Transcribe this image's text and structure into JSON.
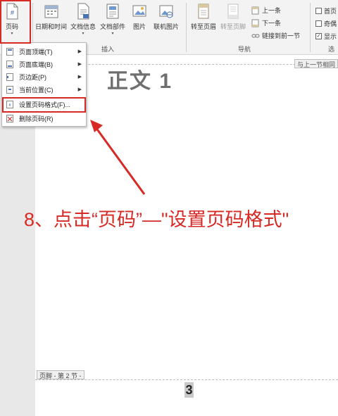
{
  "ribbon": {
    "page_number_button": "页码",
    "datetime_button": "日期和时间",
    "docinfo_button": "文档信息",
    "docparts_button": "文档部件",
    "picture_button": "图片",
    "online_picture_button": "联机图片",
    "goto_header_button": "转至页眉",
    "goto_footer_button": "转至页脚",
    "prev_button": "上一条",
    "next_button": "下一条",
    "link_prev_button": "链接到前一节",
    "insert_group": "插入",
    "nav_group": "导航",
    "right_group_fragment": "选",
    "options": {
      "first_page": "首页",
      "odd_even": "奇偶",
      "show": "显示"
    }
  },
  "menu": {
    "items": [
      {
        "label": "页面顶端(T)"
      },
      {
        "label": "页面底端(B)"
      },
      {
        "label": "页边距(P)"
      },
      {
        "label": "当前位置(C)"
      },
      {
        "label": "设置页码格式(F)..."
      },
      {
        "label": "删除页码(R)"
      }
    ]
  },
  "document": {
    "header_tag": "与上一节相同",
    "body_title": "正文 1",
    "footer_tag": "页脚 - 第 2 节 -",
    "page_number": "3"
  },
  "annotation": {
    "instruction": "8、点击“页码”—\"设置页码格式\""
  },
  "colors": {
    "annotation_red": "#d82a25",
    "ribbon_bg": "#f3f3f3",
    "body_title_gray": "#6f6f6f"
  }
}
